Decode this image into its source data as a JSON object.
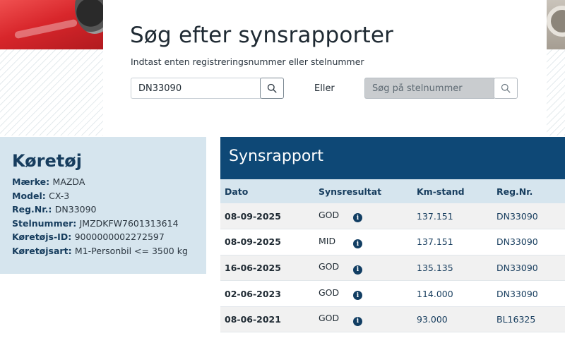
{
  "search": {
    "title": "Søg efter synsrapporter",
    "subtitle": "Indtast enten registreringsnummer eller stelnummer",
    "reg_value": "DN33090",
    "or_label": "Eller",
    "vin_placeholder": "Søg på stelnummer"
  },
  "vehicle": {
    "title": "Køretøj",
    "fields": [
      {
        "label": "Mærke",
        "value": "MAZDA"
      },
      {
        "label": "Model",
        "value": "CX-3"
      },
      {
        "label": "Reg.Nr.",
        "value": "DN33090"
      },
      {
        "label": "Stelnummer",
        "value": "JMZDKFW7601313614"
      },
      {
        "label": "Køretøjs-ID",
        "value": "9000000002272597"
      },
      {
        "label": "Køretøjsart",
        "value": "M1-Personbil <= 3500 kg"
      }
    ]
  },
  "report": {
    "title": "Synsrapport",
    "columns": [
      "Dato",
      "Synsresultat",
      "Km-stand",
      "Reg.Nr."
    ],
    "rows": [
      {
        "date": "08-09-2025",
        "result": "GOD",
        "km": "137.151",
        "reg": "DN33090"
      },
      {
        "date": "08-09-2025",
        "result": "MID",
        "km": "137.151",
        "reg": "DN33090"
      },
      {
        "date": "16-06-2025",
        "result": "GOD",
        "km": "135.135",
        "reg": "DN33090"
      },
      {
        "date": "02-06-2023",
        "result": "GOD",
        "km": "114.000",
        "reg": "DN33090"
      },
      {
        "date": "08-06-2021",
        "result": "GOD",
        "km": "93.000",
        "reg": "BL16325"
      }
    ]
  },
  "icons": {
    "search": "search-icon",
    "info": "info-icon",
    "info_glyph": "i"
  },
  "colors": {
    "brand_dark": "#0e4876",
    "panel_light": "#d6e5ee",
    "heading_blue": "#173d5e"
  }
}
